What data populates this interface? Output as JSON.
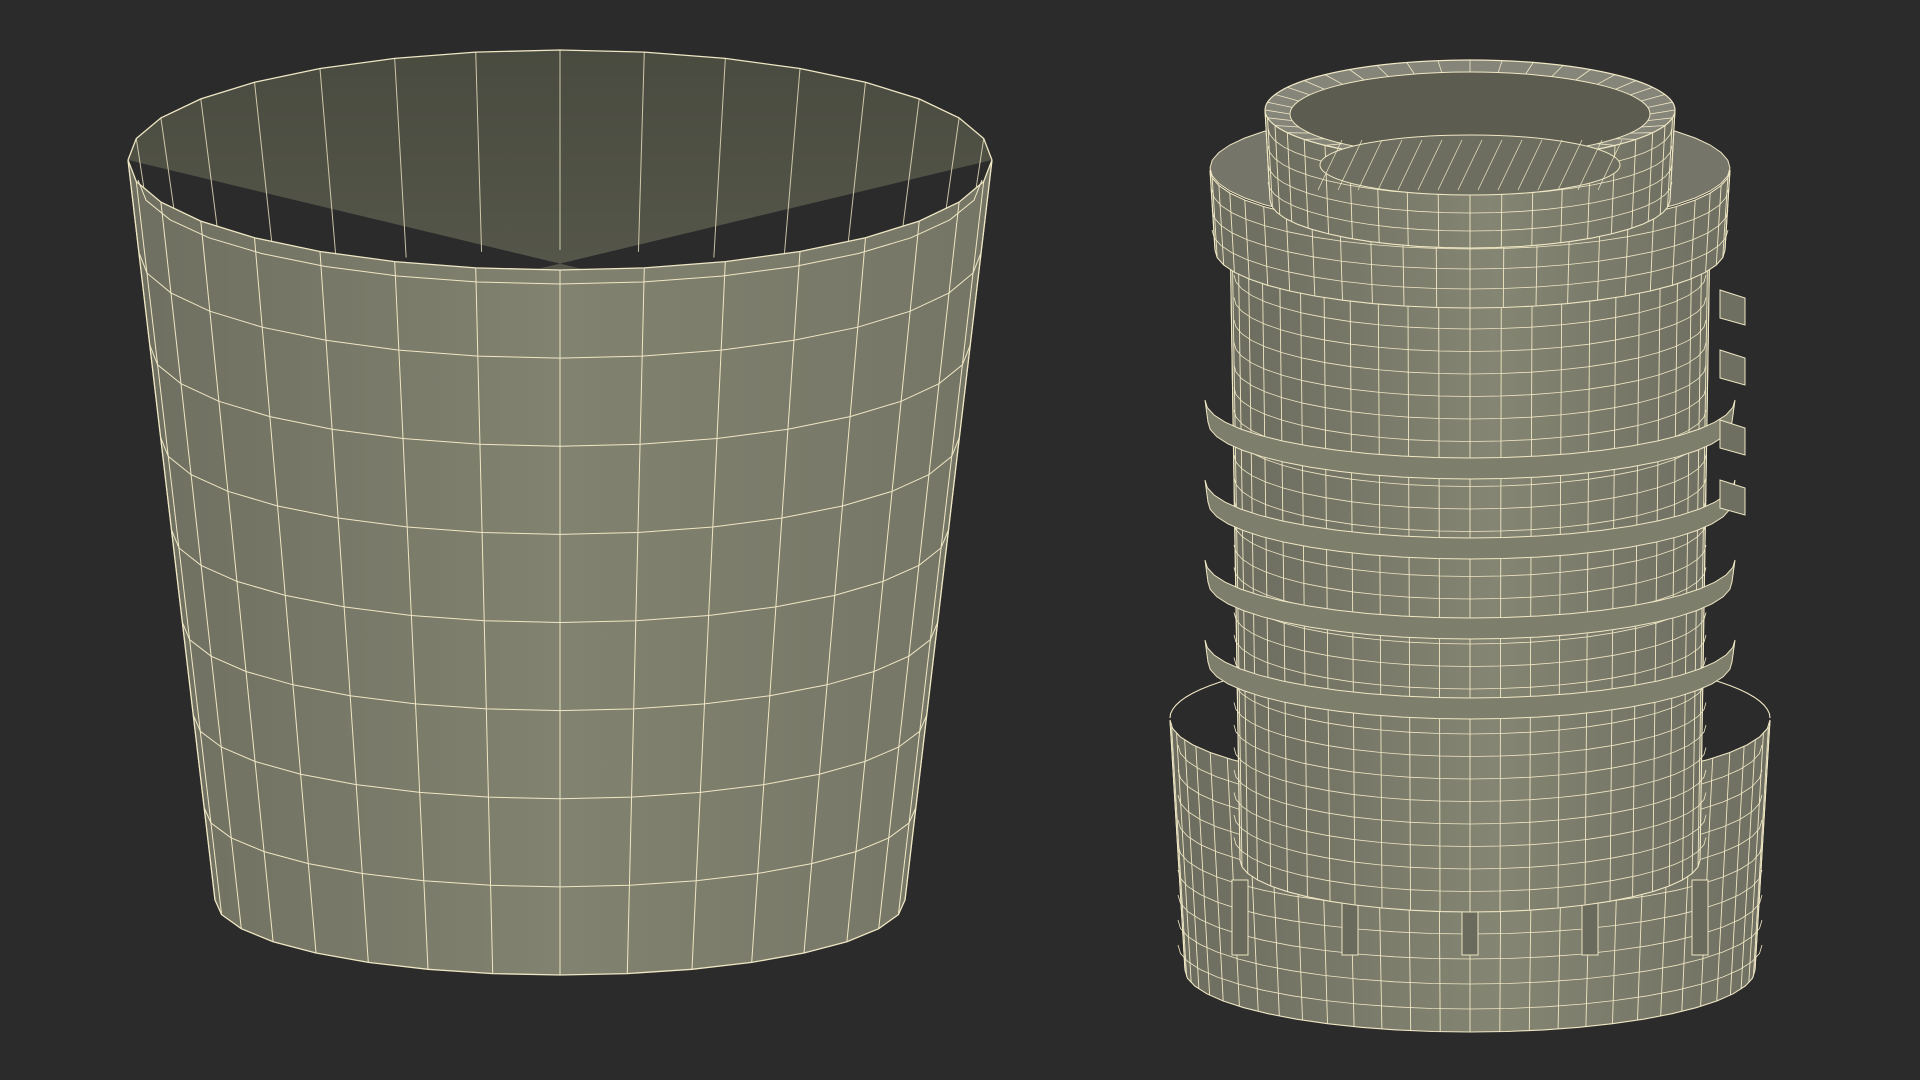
{
  "scene": {
    "background": "#2b2b2b",
    "wire_color": "#efe7c4",
    "surface_color": "#7b7b6c",
    "inner_color": "#55574a",
    "objects": [
      {
        "name": "plain-pot-wireframe",
        "shape": "tapered 16-sided cylinder, open top"
      },
      {
        "name": "nursery-pot-insert-wireframe",
        "shape": "ribbed cylinder with rim and saucer base"
      }
    ]
  }
}
